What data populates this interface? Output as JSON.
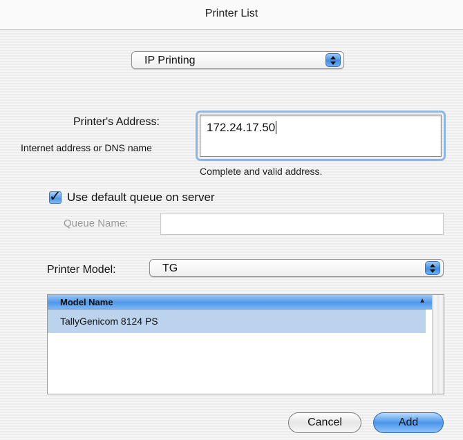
{
  "window": {
    "title": "Printer List"
  },
  "connection_popup": {
    "value": "IP Printing"
  },
  "address": {
    "label": "Printer's Address:",
    "sublabel": "Internet address or DNS name",
    "value": "172.24.17.50",
    "status": "Complete and valid address."
  },
  "queue": {
    "checkbox_label": "Use default queue on server",
    "checked": true,
    "name_label": "Queue Name:",
    "name_value": ""
  },
  "model": {
    "label": "Printer Model:",
    "popup_value": "TG",
    "column_header": "Model Name",
    "rows": [
      "TallyGenicom 8124 PS"
    ]
  },
  "buttons": {
    "cancel": "Cancel",
    "add": "Add"
  }
}
